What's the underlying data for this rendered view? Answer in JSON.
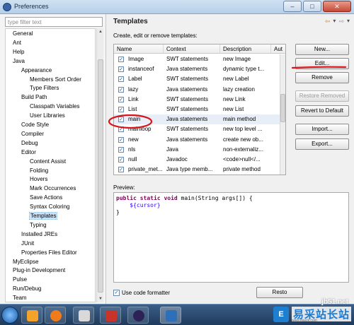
{
  "window": {
    "title": "Preferences",
    "min": "–",
    "max": "□",
    "close": "✕"
  },
  "filter": {
    "placeholder": "type filter text"
  },
  "tree": [
    {
      "label": "General",
      "level": 0
    },
    {
      "label": "Ant",
      "level": 0
    },
    {
      "label": "Help",
      "level": 0
    },
    {
      "label": "Java",
      "level": 0
    },
    {
      "label": "Appearance",
      "level": 1
    },
    {
      "label": "Members Sort Order",
      "level": 2
    },
    {
      "label": "Type Filters",
      "level": 2
    },
    {
      "label": "Build Path",
      "level": 1
    },
    {
      "label": "Classpath Variables",
      "level": 2
    },
    {
      "label": "User Libraries",
      "level": 2
    },
    {
      "label": "Code Style",
      "level": 1
    },
    {
      "label": "Compiler",
      "level": 1
    },
    {
      "label": "Debug",
      "level": 1
    },
    {
      "label": "Editor",
      "level": 1
    },
    {
      "label": "Content Assist",
      "level": 2
    },
    {
      "label": "Folding",
      "level": 2
    },
    {
      "label": "Hovers",
      "level": 2
    },
    {
      "label": "Mark Occurrences",
      "level": 2
    },
    {
      "label": "Save Actions",
      "level": 2
    },
    {
      "label": "Syntax Coloring",
      "level": 2
    },
    {
      "label": "Templates",
      "level": 2,
      "selected": true
    },
    {
      "label": "Typing",
      "level": 2
    },
    {
      "label": "Installed JREs",
      "level": 1
    },
    {
      "label": "JUnit",
      "level": 1
    },
    {
      "label": "Properties Files Editor",
      "level": 1
    },
    {
      "label": "MyEclipse",
      "level": 0
    },
    {
      "label": "Plug-in Development",
      "level": 0
    },
    {
      "label": "Pulse",
      "level": 0
    },
    {
      "label": "Run/Debug",
      "level": 0
    },
    {
      "label": "Team",
      "level": 0
    }
  ],
  "page": {
    "title": "Templates",
    "description": "Create, edit or remove templates:",
    "nav_back": "⇦",
    "nav_forward": "⇨",
    "nav_menu": "▾"
  },
  "table": {
    "columns": [
      "Name",
      "Context",
      "Description",
      "Aut"
    ],
    "rows": [
      {
        "name": "Image",
        "context": "SWT statements",
        "description": "new Image"
      },
      {
        "name": "instanceof",
        "context": "Java statements",
        "description": "dynamic type t..."
      },
      {
        "name": "Label",
        "context": "SWT statements",
        "description": "new Label"
      },
      {
        "name": "lazy",
        "context": "Java statements",
        "description": "lazy creation"
      },
      {
        "name": "Link",
        "context": "SWT statements",
        "description": "new Link"
      },
      {
        "name": "List",
        "context": "SWT statements",
        "description": "new List"
      },
      {
        "name": "main",
        "context": "Java statements",
        "description": "main method",
        "highlight": true
      },
      {
        "name": "mainloop",
        "context": "SWT statements",
        "description": "new top level ..."
      },
      {
        "name": "new",
        "context": "Java statements",
        "description": "create new ob..."
      },
      {
        "name": "nls",
        "context": "Java",
        "description": "non-externaliz..."
      },
      {
        "name": "null",
        "context": "Javadoc",
        "description": "<code>null</..."
      },
      {
        "name": "private_met...",
        "context": "Java type memb...",
        "description": "private method"
      }
    ],
    "check_mark": "✓"
  },
  "buttons": {
    "new": "New...",
    "edit": "Edit...",
    "remove": "Remove",
    "restore_removed": "Restore Removed",
    "revert_to_default": "Revert to Default",
    "import": "Import...",
    "export": "Export..."
  },
  "preview": {
    "label": "Preview:",
    "kw1": "public",
    "kw2": "static",
    "kw3": "void",
    "sig": " main(String args[]) {",
    "indent": "    ",
    "cursor": "${cursor}",
    "close": "}"
  },
  "formatter": {
    "label": "Use code formatter",
    "check": "✓"
  },
  "restore_button": "Resto",
  "watermark": {
    "url": "jb51.net",
    "brand": "易采站长站",
    "logo": "E",
    "sub": "www.easck.com"
  },
  "colors": {
    "annotation": "#d9141b",
    "selection": "#cfe3f7",
    "keyword": "#7f0055"
  }
}
